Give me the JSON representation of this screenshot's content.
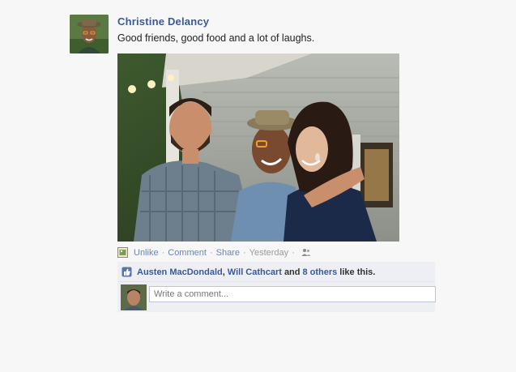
{
  "post": {
    "author": "Christine Delancy",
    "status": "Good friends, good food and a lot of laughs."
  },
  "actions": {
    "unlike": "Unlike",
    "comment": "Comment",
    "share": "Share",
    "timestamp": "Yesterday",
    "separator": "·",
    "audience_icon": "people-icon",
    "app_icon": "photo-app-icon"
  },
  "likes": {
    "icon": "thumbs-up-icon",
    "name_1": "Austen MacDondald",
    "comma": ",",
    "name_2": "Will Cathcart",
    "and": "and",
    "others": "8 others",
    "suffix": "like this."
  },
  "comment_input": {
    "placeholder": "Write a comment..."
  },
  "colors": {
    "link": "#3b5998",
    "muted_link": "#6d84b4",
    "ufi_bg": "#edeff4",
    "page_bg": "#f7f7f7"
  }
}
